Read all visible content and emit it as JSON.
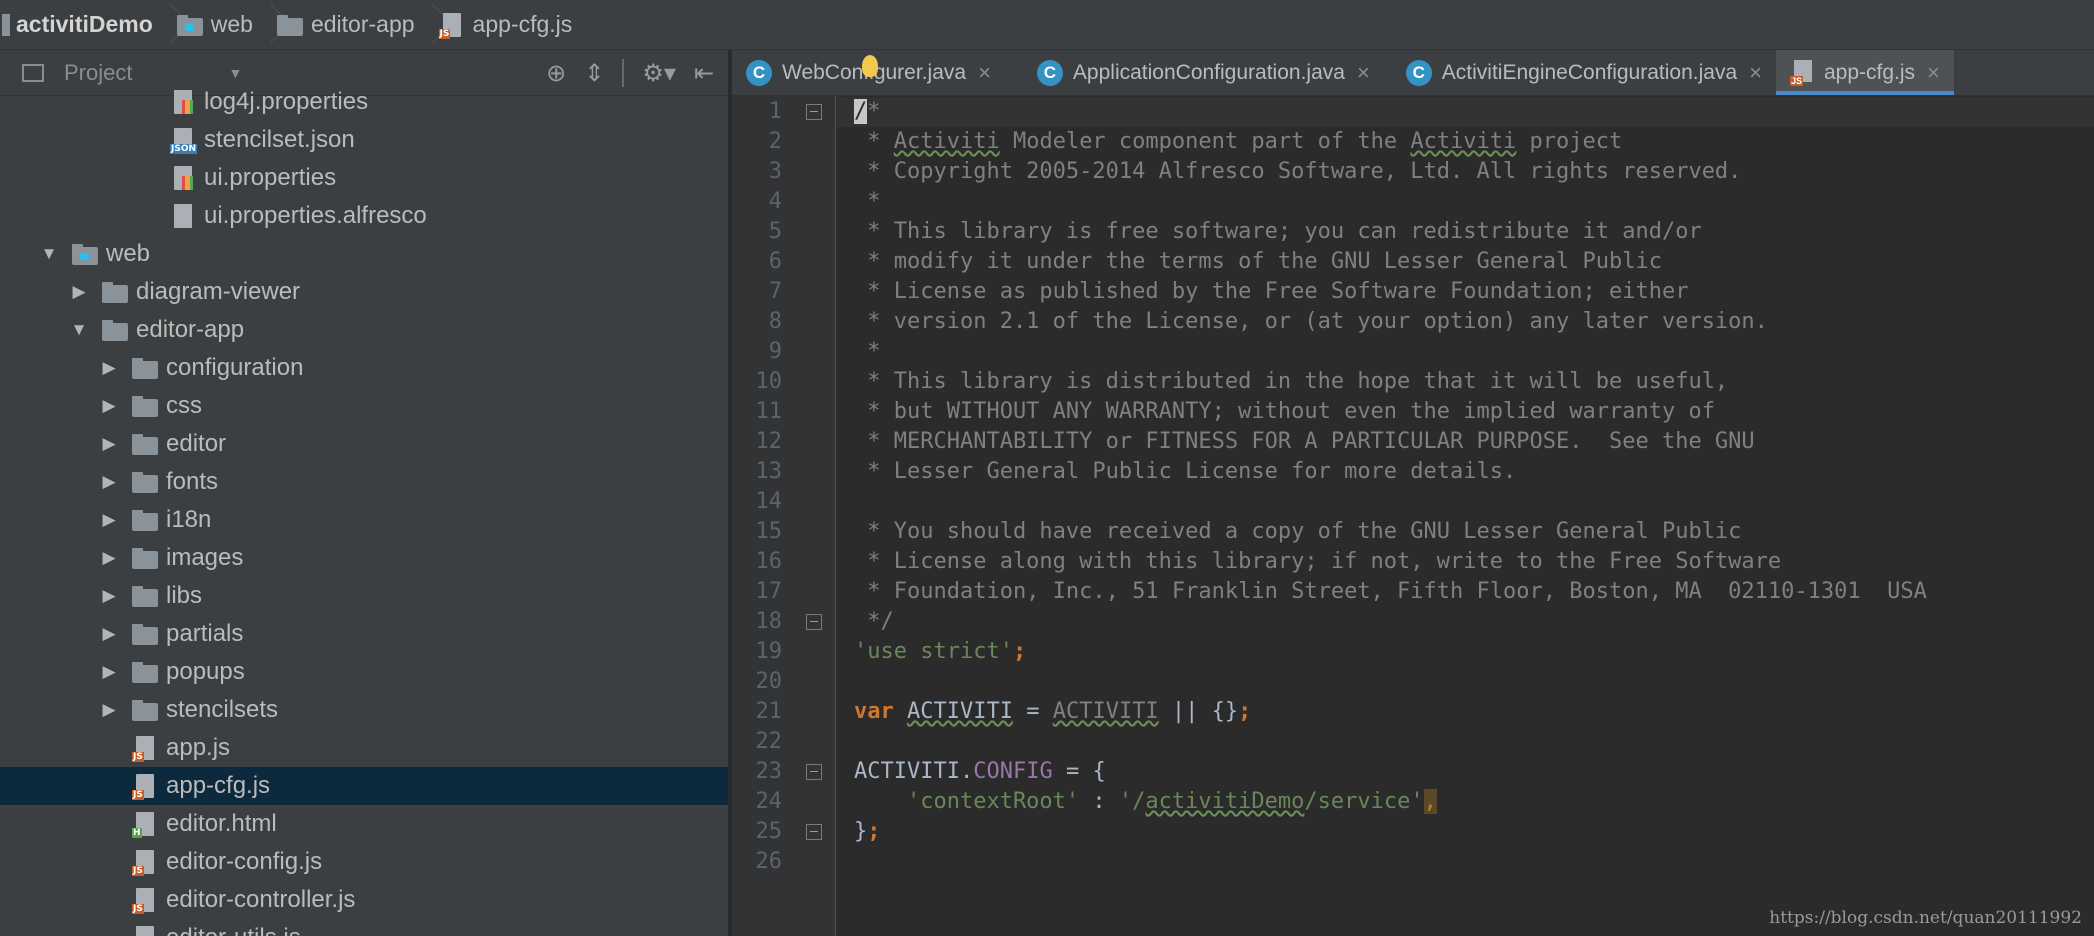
{
  "breadcrumb": [
    {
      "label": "activitiDemo",
      "icon": "module-icon"
    },
    {
      "label": "web",
      "icon": "web-folder-icon"
    },
    {
      "label": "editor-app",
      "icon": "folder-icon"
    },
    {
      "label": "app-cfg.js",
      "icon": "js-file-icon"
    }
  ],
  "project_panel": {
    "title": "Project",
    "tools": [
      "locate-icon",
      "collapse-all-icon",
      "settings-icon",
      "hide-panel-icon"
    ]
  },
  "tree": [
    {
      "label": "log4j.properties",
      "type": "properties",
      "depth": 3,
      "arrow": ""
    },
    {
      "label": "stencilset.json",
      "type": "json",
      "depth": 3,
      "arrow": ""
    },
    {
      "label": "ui.properties",
      "type": "properties",
      "depth": 3,
      "arrow": ""
    },
    {
      "label": "ui.properties.alfresco",
      "type": "text",
      "depth": 3,
      "arrow": ""
    },
    {
      "label": "web",
      "type": "webfolder",
      "depth": 0,
      "arrow": "▼"
    },
    {
      "label": "diagram-viewer",
      "type": "folder",
      "depth": 1,
      "arrow": "▶"
    },
    {
      "label": "editor-app",
      "type": "folder",
      "depth": 1,
      "arrow": "▼"
    },
    {
      "label": "configuration",
      "type": "folder",
      "depth": 2,
      "arrow": "▶"
    },
    {
      "label": "css",
      "type": "folder",
      "depth": 2,
      "arrow": "▶"
    },
    {
      "label": "editor",
      "type": "folder",
      "depth": 2,
      "arrow": "▶"
    },
    {
      "label": "fonts",
      "type": "folder",
      "depth": 2,
      "arrow": "▶"
    },
    {
      "label": "i18n",
      "type": "folder",
      "depth": 2,
      "arrow": "▶"
    },
    {
      "label": "images",
      "type": "folder",
      "depth": 2,
      "arrow": "▶"
    },
    {
      "label": "libs",
      "type": "folder",
      "depth": 2,
      "arrow": "▶"
    },
    {
      "label": "partials",
      "type": "folder",
      "depth": 2,
      "arrow": "▶"
    },
    {
      "label": "popups",
      "type": "folder",
      "depth": 2,
      "arrow": "▶"
    },
    {
      "label": "stencilsets",
      "type": "folder",
      "depth": 2,
      "arrow": "▶"
    },
    {
      "label": "app.js",
      "type": "js",
      "depth": 2,
      "arrow": ""
    },
    {
      "label": "app-cfg.js",
      "type": "js",
      "depth": 2,
      "arrow": "",
      "selected": true
    },
    {
      "label": "editor.html",
      "type": "html",
      "depth": 2,
      "arrow": ""
    },
    {
      "label": "editor-config.js",
      "type": "js",
      "depth": 2,
      "arrow": ""
    },
    {
      "label": "editor-controller.js",
      "type": "js",
      "depth": 2,
      "arrow": ""
    },
    {
      "label": "editor-utils.js",
      "type": "js",
      "depth": 2,
      "arrow": ""
    }
  ],
  "tabs": [
    {
      "label": "WebConfigurer.java",
      "kind": "class"
    },
    {
      "label": "ApplicationConfiguration.java",
      "kind": "class"
    },
    {
      "label": "ActivitiEngineConfiguration.java",
      "kind": "class"
    },
    {
      "label": "app-cfg.js",
      "kind": "js",
      "active": true
    }
  ],
  "code_lines": [
    "/*",
    " * Activiti Modeler component part of the Activiti project",
    " * Copyright 2005-2014 Alfresco Software, Ltd. All rights reserved.",
    " *",
    " * This library is free software; you can redistribute it and/or",
    " * modify it under the terms of the GNU Lesser General Public",
    " * License as published by the Free Software Foundation; either",
    " * version 2.1 of the License, or (at your option) any later version.",
    " *",
    " * This library is distributed in the hope that it will be useful,",
    " * but WITHOUT ANY WARRANTY; without even the implied warranty of",
    " * MERCHANTABILITY or FITNESS FOR A PARTICULAR PURPOSE.  See the GNU",
    " * Lesser General Public License for more details.",
    "",
    " * You should have received a copy of the GNU Lesser General Public",
    " * License along with this library; if not, write to the Free Software",
    " * Foundation, Inc., 51 Franklin Street, Fifth Floor, Boston, MA  02110-1301  USA",
    " */",
    "'use strict';",
    "",
    "var ACTIVITI = ACTIVITI || {};",
    "",
    "ACTIVITI.CONFIG = {",
    "    'contextRoot' : '/activitiDemo/service',",
    "};",
    ""
  ],
  "line_numbers": [
    "1",
    "2",
    "3",
    "4",
    "5",
    "6",
    "7",
    "8",
    "9",
    "10",
    "11",
    "12",
    "13",
    "14",
    "15",
    "16",
    "17",
    "18",
    "19",
    "20",
    "21",
    "22",
    "23",
    "24",
    "25",
    "26"
  ],
  "watermark": "https://blog.csdn.net/quan20111992",
  "colors": {
    "keyword": "#cc7832",
    "string": "#6a8759",
    "property": "#9876aa",
    "comment": "#808080",
    "selection": "#0d293e",
    "tab_accent": "#4a88c7"
  }
}
